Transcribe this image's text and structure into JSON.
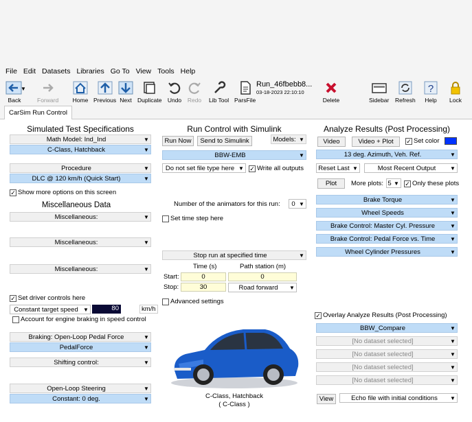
{
  "menu": [
    "File",
    "Edit",
    "Datasets",
    "Libraries",
    "Go To",
    "View",
    "Tools",
    "Help"
  ],
  "toolbar": {
    "back": "Back",
    "forward": "Forward",
    "home": "Home",
    "previous": "Previous",
    "next": "Next",
    "duplicate": "Duplicate",
    "undo": "Undo",
    "redo": "Redo",
    "libtool": "Lib Tool",
    "parsfile": "ParsFile",
    "run_name": "Run_46fbebb8...",
    "run_date": "03-18-2023 22:10:10",
    "delete": "Delete",
    "sidebar": "Sidebar",
    "refresh": "Refresh",
    "help": "Help",
    "lock": "Lock"
  },
  "tab": "CarSim Run Control",
  "left": {
    "header": "Simulated Test Specifications",
    "math_model": "Math Model: Ind_Ind",
    "vehicle": "C-Class, Hatchback",
    "procedure": "Procedure",
    "procedure_val": "DLC @ 120 km/h (Quick Start)",
    "more_options": "Show more options on this screen",
    "misc_header": "Miscellaneous Data",
    "misc1": "Miscellaneous:",
    "misc2": "Miscellaneous:",
    "misc3": "Miscellaneous:",
    "driver_controls": "Set driver controls here",
    "speed_mode": "Constant target speed",
    "speed_val": "80",
    "speed_unit": "km/h",
    "engine_braking": "Account for engine braking in speed control",
    "braking": "Braking: Open-Loop Pedal Force",
    "braking_val": "PedalForce",
    "shifting": "Shifting control:",
    "steering": "Open-Loop Steering",
    "steering_val": "Constant: 0 deg."
  },
  "middle": {
    "header": "Run Control with Simulink",
    "run_now": "Run Now",
    "send": "Send to Simulink",
    "models": "Models:",
    "model_val": "BBW-EMB",
    "file_type": "Do not set file type here",
    "write_outputs": "Write all outputs",
    "animators_label": "Number of the animators for this run:",
    "animators_val": "0",
    "time_step": "Set time step here",
    "stop_mode": "Stop run at specified time",
    "col_time": "Time (s)",
    "col_station": "Path station (m)",
    "start_label": "Start:",
    "start_time": "0",
    "start_station": "0",
    "stop_label": "Stop:",
    "stop_time": "30",
    "direction": "Road forward",
    "advanced": "Advanced settings",
    "vehicle_caption": "C-Class, Hatchback",
    "vehicle_sub": "( C-Class )"
  },
  "right": {
    "header": "Analyze Results (Post Processing)",
    "video": "Video",
    "video_plot": "Video + Plot",
    "set_color": "Set color",
    "color": "#0033ff",
    "camera": "13 deg. Azimuth, Veh. Ref.",
    "reset_last": "Reset Last",
    "recent_output": "Most Recent Output",
    "plot": "Plot",
    "more_plots": "More plots:",
    "more_plots_val": "5",
    "only_these": "Only these plots",
    "plots": [
      "Brake Torque",
      "Wheel Speeds",
      "Brake Control: Master Cyl. Pressure",
      "Brake Control: Pedal Force vs. Time",
      "Wheel Cylinder Pressures"
    ],
    "overlay": "Overlay Analyze Results (Post Processing)",
    "compare": "BBW_Compare",
    "ds1": "[No dataset selected]",
    "ds2": "[No dataset selected]",
    "ds3": "[No dataset selected]",
    "ds4": "[No dataset selected]",
    "view": "View",
    "echo": "Echo file with initial conditions"
  }
}
